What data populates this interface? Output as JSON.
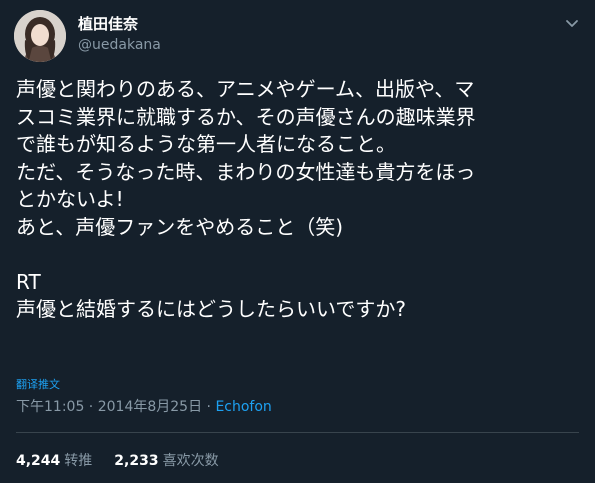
{
  "author": {
    "name": "植田佳奈",
    "handle": "@uedakana"
  },
  "tweet": {
    "lines": [
      "声優と関わりのある、アニメやゲーム、出版や、マ",
      "スコミ業界に就職するか、その声優さんの趣味業界",
      "で誰もが知るような第一人者になること。",
      "ただ、そうなった時、まわりの女性達も貴方をほっ",
      "とかないよ!",
      "あと、声優ファンをやめること（笑)",
      "",
      "RT",
      "声優と結婚するにはどうしたらいいですか?"
    ]
  },
  "translate_label": "翻译推文",
  "meta": {
    "time": "下午11:05",
    "separator": " · ",
    "date": "2014年8月25日",
    "source": "Echofon"
  },
  "stats": {
    "retweets_count": "4,244",
    "retweets_label": "转推",
    "likes_count": "2,233",
    "likes_label": "喜欢次数"
  },
  "colors": {
    "background": "#15202b",
    "text": "#ffffff",
    "secondary": "#8899a6",
    "accent": "#1da1f2"
  },
  "icons": {
    "caret": "chevron-down-icon"
  }
}
